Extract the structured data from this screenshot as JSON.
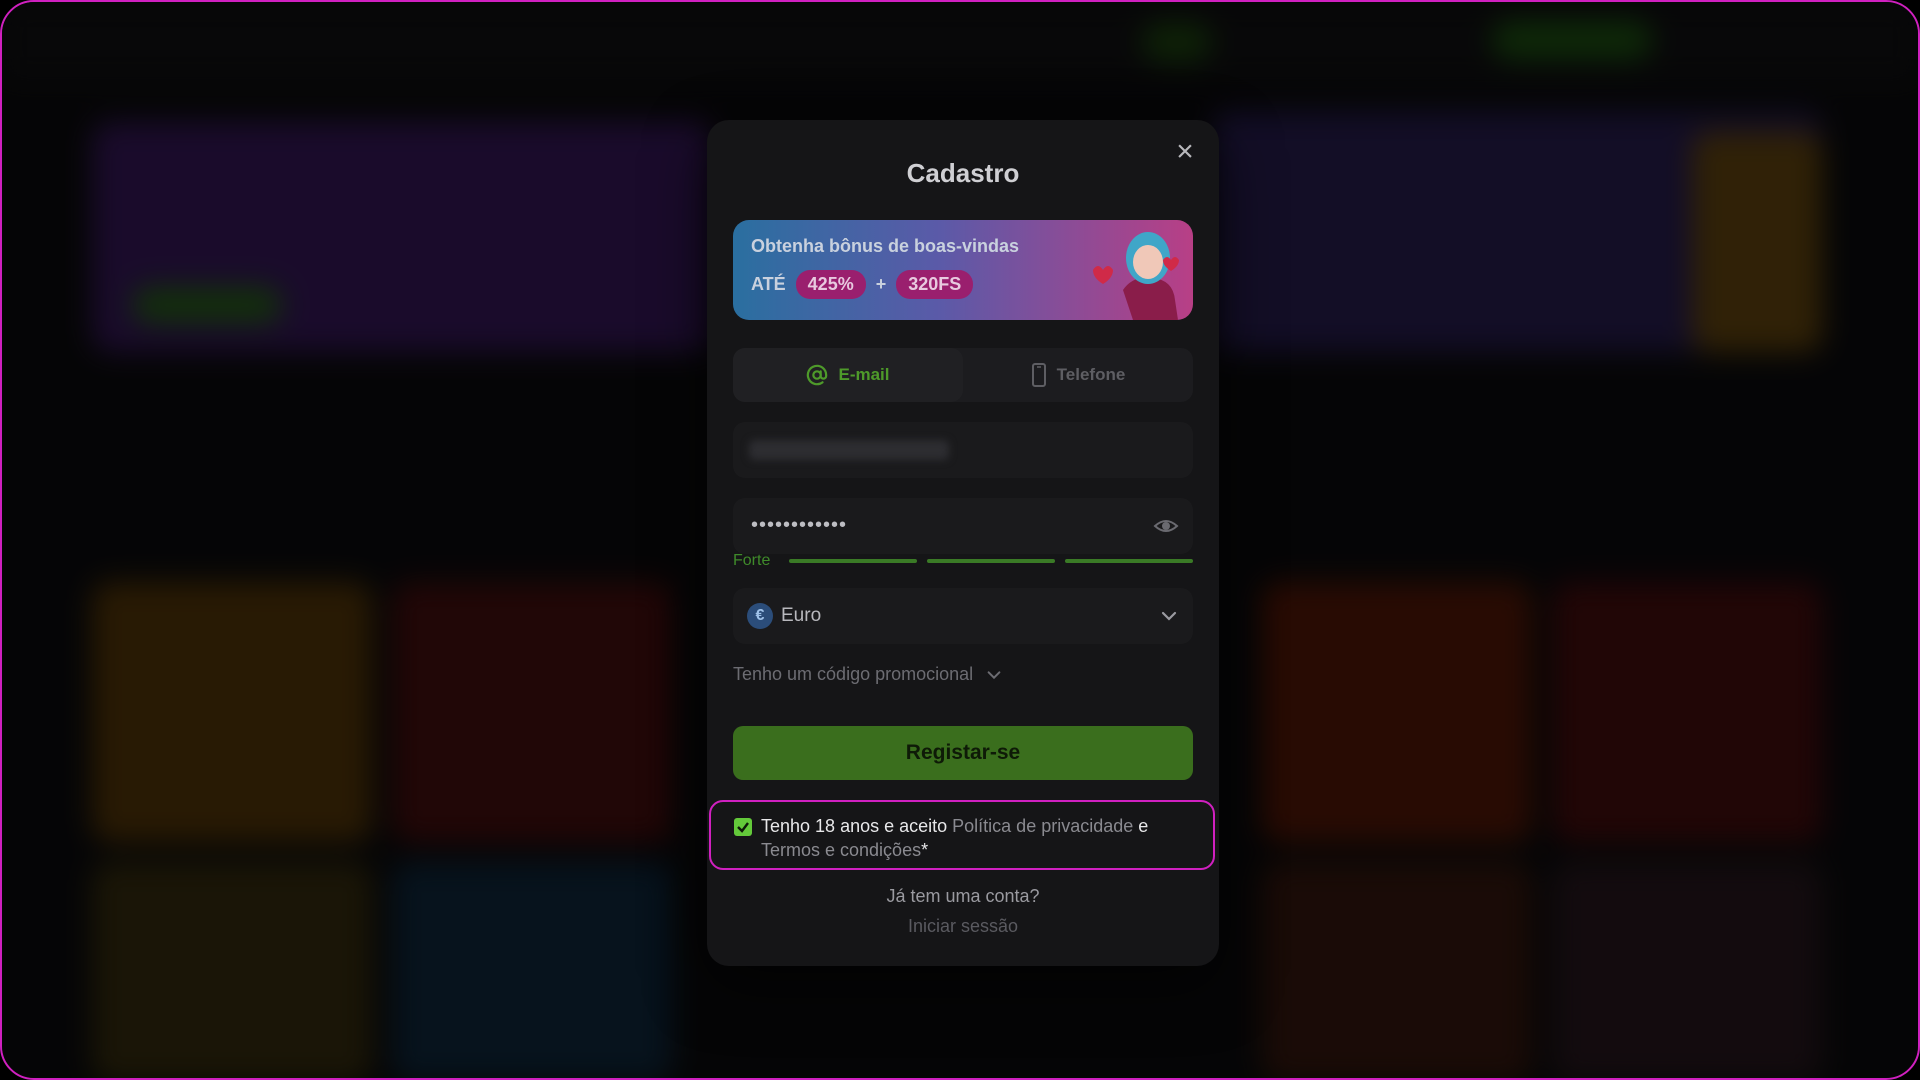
{
  "modal": {
    "title": "Cadastro",
    "close_icon": "close-icon",
    "banner": {
      "headline": "Obtenha bônus de boas-vindas",
      "prefix": "ATÉ",
      "percent": "425%",
      "plus": "+",
      "free_spins": "320FS"
    },
    "tabs": [
      {
        "label": "E-mail",
        "icon": "at-icon",
        "active": true
      },
      {
        "label": "Telefone",
        "icon": "phone-icon",
        "active": false
      }
    ],
    "password": {
      "value": "••••••••••••",
      "strength_label": "Forte",
      "strength_level": 1.0
    },
    "currency": {
      "label": "Euro",
      "symbol": "€"
    },
    "promo_label": "Tenho um código promocional",
    "register_label": "Registar-se",
    "terms": {
      "checked": true,
      "text_start": "Tenho 18 anos e aceito ",
      "privacy_link": "Política de privacidade",
      "connector": " e",
      "terms_link": "Termos e condições",
      "suffix": "*"
    },
    "already_account": "Já tem uma conta?",
    "login_link": "Iniciar sessão"
  },
  "colors": {
    "accent_green": "#4e9a2a",
    "button_green": "#3a6e1d",
    "highlight_magenta": "#d020c0"
  }
}
